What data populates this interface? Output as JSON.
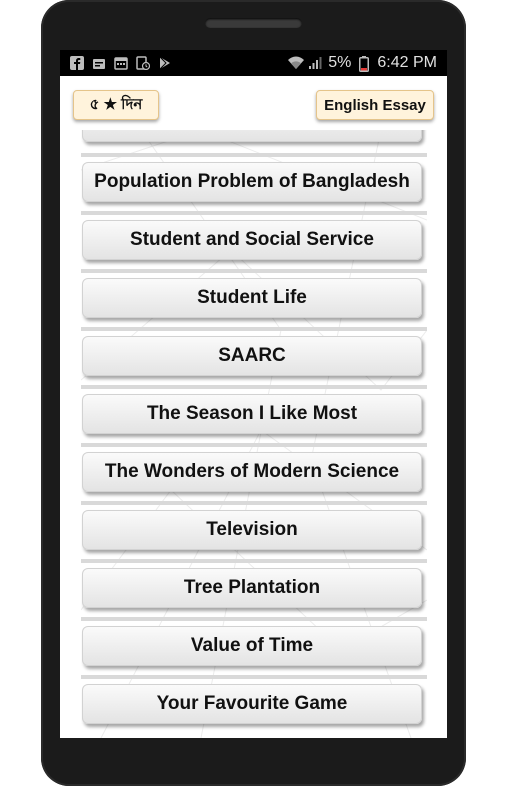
{
  "status_bar": {
    "icons": [
      "facebook-icon",
      "notification-icon",
      "calendar-icon",
      "clock-icon",
      "play-store-icon"
    ],
    "battery": "5%",
    "time": "6:42 PM"
  },
  "app_bar": {
    "rate_label": "৫ ★ দিন",
    "english_essay_label": "English Essay"
  },
  "essays": [
    "Population Problem of Bangladesh",
    "Student and Social Service",
    "Student Life",
    "SAARC",
    "The Season I Like Most",
    "The Wonders of Modern Science",
    "Television",
    "Tree Plantation",
    "Value of Time",
    "Your Favourite Game"
  ]
}
